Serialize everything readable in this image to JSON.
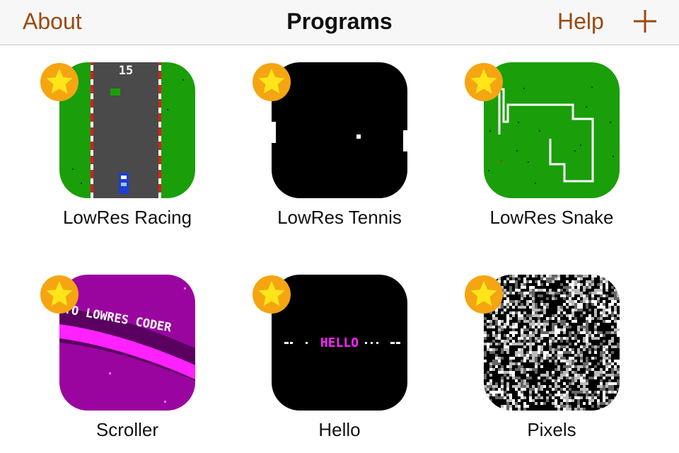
{
  "navbar": {
    "about_label": "About",
    "title": "Programs",
    "help_label": "Help",
    "add_icon": "plus-icon"
  },
  "colors": {
    "accent": "#9a4a10",
    "star_orange": "#f5a512",
    "star_yellow": "#ffe51a",
    "grass_green": "#1a9e0a",
    "road_gray": "#4a4a4a",
    "magenta": "#ff22ff",
    "purple": "#9a05a0"
  },
  "programs": [
    {
      "name": "LowRes Racing",
      "favorite": true,
      "icon": "racing-icon",
      "score_text": "15"
    },
    {
      "name": "LowRes Tennis",
      "favorite": true,
      "icon": "tennis-icon"
    },
    {
      "name": "LowRes Snake",
      "favorite": true,
      "icon": "snake-icon"
    },
    {
      "name": "Scroller",
      "favorite": true,
      "icon": "scroller-icon",
      "banner_text": "TO LOWRES CODER"
    },
    {
      "name": "Hello",
      "favorite": true,
      "icon": "hello-icon",
      "screen_text": "HELLO"
    },
    {
      "name": "Pixels",
      "favorite": true,
      "icon": "pixels-icon"
    }
  ]
}
